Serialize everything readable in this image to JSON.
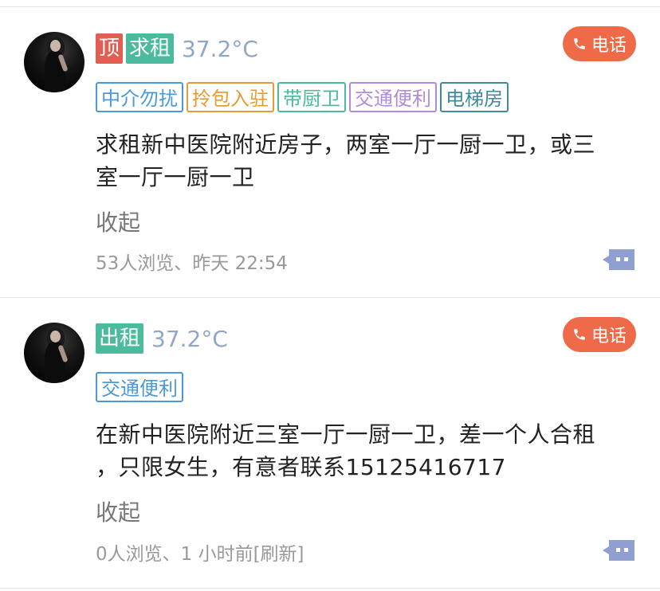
{
  "posts": [
    {
      "badges": [
        "顶",
        "求租"
      ],
      "temperature": "37.2°C",
      "call_label": "电话",
      "tags": [
        "中介勿扰",
        "拎包入驻",
        "带厨卫",
        "交通便利",
        "电梯房"
      ],
      "content_line1": "求租新中医院附近房子，两室一厅一厨一卫，或三",
      "content_line2": "室一厅一厨一卫",
      "collapse_label": "收起",
      "meta": "53人浏览、昨天 22:54"
    },
    {
      "badges": [
        "出租"
      ],
      "temperature": "37.2°C",
      "call_label": "电话",
      "tags": [
        "交通便利"
      ],
      "content_line1": "在新中医院附近三室一厅一厨一卫，差一个人合租",
      "content_line2": "，只限女生，有意者联系15125416717",
      "collapse_label": "收起",
      "meta": "0人浏览、1 小时前[刷新]"
    }
  ],
  "colors": {
    "badge_top": "#e25d52",
    "badge_rent": "#4cbb9d",
    "temperature": "#8fa8c8",
    "call_button": "#ef6a48",
    "comment_icon": "#8f9fd0"
  }
}
